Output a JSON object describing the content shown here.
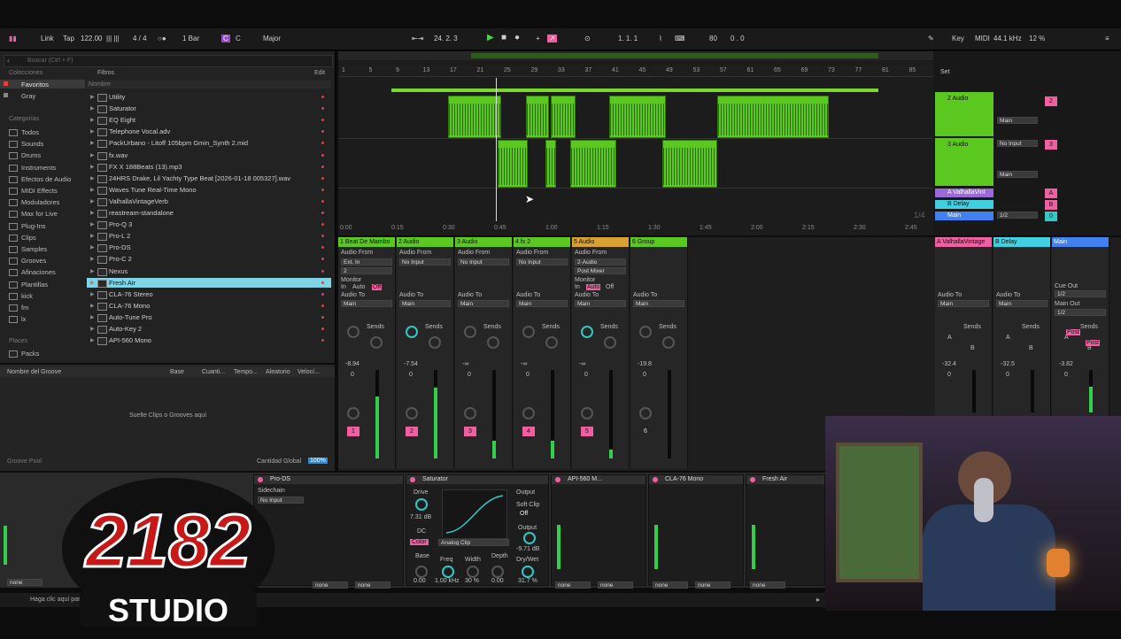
{
  "transport": {
    "link": "Link",
    "tap": "Tap",
    "tempo": "122.00",
    "signature": "4 / 4",
    "quantize": "1 Bar",
    "key": "C",
    "scale": "Major",
    "position": "24.  2.  3",
    "loop_start": "1.  1.  1",
    "zoom": "80",
    "zoom_sub": "0 . 0",
    "key_label": "Key",
    "midi_label": "MIDI",
    "sample_rate": "44.1 kHz",
    "cpu": "12 %"
  },
  "browser": {
    "search_placeholder": "Buscar (Ctrl + F)",
    "filters": "Filtros",
    "edit": "Edit",
    "collections_label": "Colecciones",
    "collections": [
      "Favoritos",
      "Gray"
    ],
    "categories_label": "Categorías",
    "categories": [
      "Todos",
      "Sounds",
      "Drums",
      "Instruments",
      "Efectos de Audio",
      "MIDI Effects",
      "Moduladores",
      "Max for Live",
      "Plug-Ins",
      "Clips",
      "Samples",
      "Grooves",
      "Afinaciones",
      "Plantillas"
    ],
    "places_extra": [
      "kick",
      "fm",
      "lx"
    ],
    "places_label": "Places",
    "packs": "Packs",
    "name_header": "Nombre",
    "files": [
      "Utility",
      "Saturator",
      "EQ Eight",
      "Telephone Vocal.adv",
      "PackUrbano - Litoff 105bpm Gmin_Synth 2.mid",
      "fx.wav",
      "FX X 188Beats (13).mp3",
      "24HRS Drake, Lil Yachty Type Beat [2026-01-18 005327].wav",
      "Waves Tune Real-Time Mono",
      "ValhallaVintageVerb",
      "reastream-standalone",
      "Pro-Q 3",
      "Pro-L 2",
      "Pro-DS",
      "Pro-C 2",
      "Nexus",
      "Fresh Air",
      "CLA-76 Stereo",
      "CLA-76 Mono",
      "Auto-Tune Pro",
      "Auto-Key 2",
      "API-560 Mono"
    ],
    "selected_file": "Fresh Air"
  },
  "groove": {
    "name_col": "Nombre del Groove",
    "base_col": "Base",
    "cuant_col": "Cuanti...",
    "tempo_col": "Tempo...",
    "alea_col": "Aleatorio",
    "vel_col": "Velocí...",
    "drop_hint": "Suelte Clips o Grooves aquí",
    "pool_label": "Groove Pool",
    "global_label": "Cantidad Global",
    "global_value": "100%"
  },
  "arrangement": {
    "ruler": [
      "1",
      "5",
      "9",
      "13",
      "17",
      "21",
      "25",
      "29",
      "33",
      "37",
      "41",
      "45",
      "49",
      "53",
      "57",
      "61",
      "65",
      "69",
      "73",
      "77",
      "81",
      "85"
    ],
    "times": [
      "0:00",
      "0:15",
      "0:30",
      "0:45",
      "1:00",
      "1:15",
      "1:30",
      "1:45",
      "2:00",
      "2:15",
      "2:30",
      "2:45"
    ],
    "fraction": "1/4",
    "set_label": "Set"
  },
  "tracks_right": [
    {
      "name": "2 Audio",
      "io": "Main",
      "num": "2"
    },
    {
      "name": "3 Audio",
      "io": "No Input",
      "out": "Main",
      "num": "3"
    },
    {
      "name": "A ValhallaVint",
      "num": "A"
    },
    {
      "name": "B Delay",
      "num": "B"
    },
    {
      "name": "Main",
      "io": "1/2",
      "num": "0"
    }
  ],
  "mixer": {
    "channels": [
      {
        "name": "1 Beat De Mambo",
        "from": "Audio From",
        "src": "Ext. In",
        "sub": "2",
        "to": "Main",
        "vol": "-8.94",
        "pan": "0",
        "num": "1",
        "color": "#5ac81e"
      },
      {
        "name": "2 Audio",
        "from": "Audio From",
        "src": "No Input",
        "to": "Main",
        "vol": "-7.54",
        "pan": "0",
        "num": "2",
        "color": "#5ac81e"
      },
      {
        "name": "3 Audio",
        "from": "Audio From",
        "src": "No Input",
        "to": "Main",
        "vol": "-∞",
        "pan": "0",
        "num": "3",
        "color": "#5ac81e"
      },
      {
        "name": "4 fx 2",
        "from": "Audio From",
        "src": "No Input",
        "to": "Main",
        "vol": "-∞",
        "pan": "0",
        "num": "4",
        "color": "#5ac81e"
      },
      {
        "name": "5 Audio",
        "from": "Audio From",
        "src": "2-Audio",
        "sub": "Post Mixer",
        "to": "Main",
        "vol": "-∞",
        "pan": "0",
        "num": "5",
        "color": "#d8a030"
      },
      {
        "name": "6 Group",
        "to": "Main",
        "vol": "-19.8",
        "pan": "0",
        "num": "6",
        "color": "#5ac81e"
      }
    ],
    "returns": [
      {
        "name": "A ValhallaVintage",
        "to": "Main",
        "vol": "-32.4",
        "pan": "0",
        "color": "#f060a0"
      },
      {
        "name": "B Delay",
        "to": "Main",
        "vol": "-32.5",
        "pan": "0",
        "color": "#40d0e0"
      },
      {
        "name": "Main",
        "cue": "Cue Out",
        "cue_val": "1/2",
        "main_out": "Main Out",
        "main_val": "1/2",
        "vol": "-3.82",
        "pan": "0",
        "color": "#4080f0"
      }
    ],
    "audio_to": "Audio To",
    "monitor": "Monitor",
    "monitor_in": "In",
    "monitor_auto": "Auto",
    "monitor_off": "Off",
    "sends": "Sends",
    "send_a": "A",
    "send_b": "B",
    "post": "Post"
  },
  "devices": {
    "proDs": "Pro-DS",
    "sidechain": "Sidechain",
    "sidechain_val": "No Input",
    "saturator": "Saturator",
    "drive_label": "Drive",
    "drive": "7.31 dB",
    "dc": "DC",
    "color": "Color",
    "mode": "Analog Clip",
    "output_label": "Output",
    "soft_clip": "Soft Clip",
    "off": "Off",
    "output": "-9.71 dB",
    "base": "Base",
    "base_val": "0.00",
    "freq": "Freq",
    "freq_val": "1.00 kHz",
    "width": "Width",
    "width_val": "30 %",
    "depth": "Depth",
    "depth_val": "0.00",
    "drywet": "Dry/Wet",
    "drywet_val": "31.7 %",
    "api": "API-560 M...",
    "cla": "CLA-76 Mono",
    "freshair": "Fresh Air",
    "none": "none"
  },
  "status": "Haga clic aquí para ver la información de la versión.",
  "logo": {
    "line1": "2182",
    "line2": "STUDIO"
  }
}
